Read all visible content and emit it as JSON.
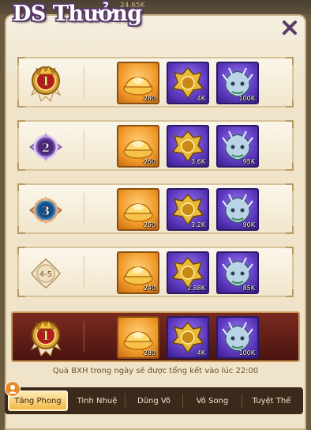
{
  "top_strip": {
    "left_value": "24.65K"
  },
  "title": "DS Thưởng",
  "colors": {
    "panel": "#efe4c9",
    "title_outline": "#5a3a68",
    "gold_item": "#f09a2a",
    "purple_item": "#5e3ac0",
    "highlight_row": "#6a1f18"
  },
  "rows": [
    {
      "rank_label": "1",
      "badge": "gold-crown-badge-icon",
      "items": [
        {
          "icon": "gold-ingot-icon",
          "qty": "280"
        },
        {
          "icon": "gold-crest-icon",
          "qty": "4K"
        },
        {
          "icon": "dragon-head-icon",
          "qty": "100K"
        }
      ]
    },
    {
      "rank_label": "2",
      "badge": "purple-badge-icon",
      "items": [
        {
          "icon": "gold-ingot-icon",
          "qty": "260"
        },
        {
          "icon": "gold-crest-icon",
          "qty": "3.6K"
        },
        {
          "icon": "dragon-head-icon",
          "qty": "95K"
        }
      ]
    },
    {
      "rank_label": "3",
      "badge": "blue-badge-icon",
      "items": [
        {
          "icon": "gold-ingot-icon",
          "qty": "250"
        },
        {
          "icon": "gold-crest-icon",
          "qty": "3.2K"
        },
        {
          "icon": "dragon-head-icon",
          "qty": "90K"
        }
      ]
    },
    {
      "rank_label": "4-5",
      "badge": "plain-badge-icon",
      "items": [
        {
          "icon": "gold-ingot-icon",
          "qty": "240"
        },
        {
          "icon": "gold-crest-icon",
          "qty": "2.88K"
        },
        {
          "icon": "dragon-head-icon",
          "qty": "85K"
        }
      ]
    },
    {
      "rank_label": "1",
      "badge": "gold-crown-badge-icon",
      "items": [
        {
          "icon": "gold-ingot-icon",
          "qty": "280"
        },
        {
          "icon": "gold-crest-icon",
          "qty": "4K"
        },
        {
          "icon": "dragon-head-icon",
          "qty": "100K"
        }
      ]
    }
  ],
  "footnote": "Quà BXH trong ngày sẽ được tổng kết vào lúc 22:00",
  "tabs": [
    {
      "label": "Tăng Phong",
      "active": true
    },
    {
      "label": "Tinh Nhuệ",
      "active": false
    },
    {
      "label": "Dũng Võ",
      "active": false
    },
    {
      "label": "Vô Song",
      "active": false
    },
    {
      "label": "Tuyệt Thế",
      "active": false
    }
  ]
}
